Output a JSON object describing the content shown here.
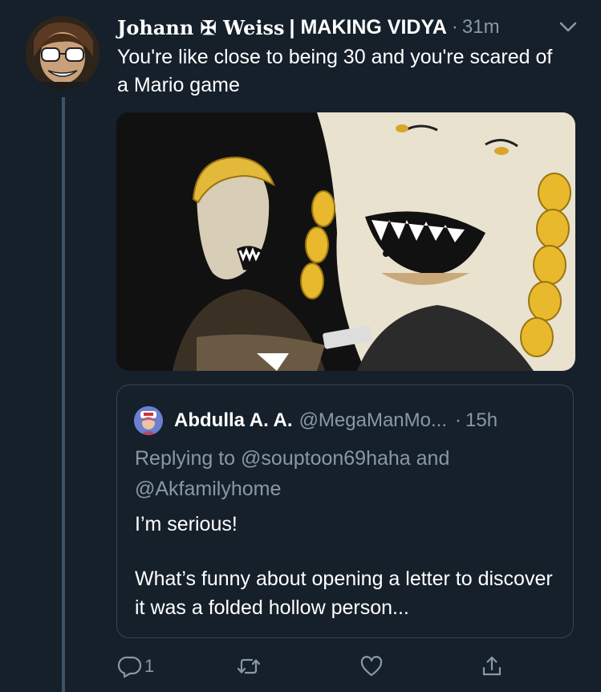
{
  "tweet": {
    "author_name_blackletter": "Johann ✠ Weiss",
    "author_name_rest": "| MAKING VIDYA",
    "separator": "·",
    "time": "31m",
    "text": "You're like close to being 30 and you're scared of a Mario game"
  },
  "quote": {
    "name": "Abdulla A. A.",
    "handle": "@MegaManMo...",
    "separator": "·",
    "time": "15h",
    "replying_prefix": "Replying to",
    "replying_to_1": "@souptoon69haha",
    "replying_and": "and",
    "replying_to_2": "@Akfamilyhome",
    "body_line_1": "I’m serious!",
    "body_line_2": "What’s funny about opening a letter to discover it was a folded hollow person..."
  },
  "actions": {
    "reply_count": "1",
    "retweet_count": "",
    "like_count": ""
  },
  "icons": {
    "caret": "chevron-down-icon",
    "reply": "reply-icon",
    "retweet": "retweet-icon",
    "like": "heart-icon",
    "share": "share-icon"
  },
  "colors": {
    "background": "#15202b",
    "secondary_text": "#8899a6",
    "border": "#38444d",
    "thread_line": "#3d5466"
  }
}
